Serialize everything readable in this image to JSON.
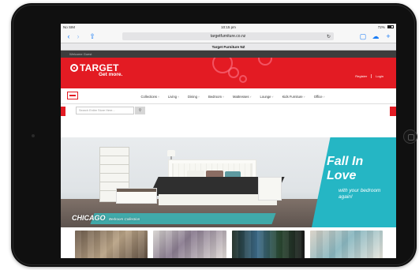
{
  "status_bar": {
    "carrier": "No SIM",
    "time": "10:15 pm",
    "battery": "72%"
  },
  "browser": {
    "url": "targetfurniture.co.nz",
    "tab_title": "Target Furniture NZ"
  },
  "site": {
    "welcome": "Welcome Guest",
    "brand": "TARGET",
    "tagline": "Get more.",
    "header_links": [
      "Register",
      "Login"
    ],
    "nav": [
      "Collections",
      "Living",
      "Dining",
      "Bedroom",
      "Mattresses",
      "Lounge",
      "Kids Furniture",
      "Office"
    ],
    "search_placeholder": "Search Entire Store Here...",
    "hero": {
      "headline": "Fall In Love",
      "sub": "with your bedroom again!",
      "collection": "CHICAGO",
      "collection_sub": "Bedroom Collection"
    }
  },
  "colors": {
    "brand_red": "#e31b23",
    "teal": "#25b6c4",
    "ios_blue": "#1a7cf5"
  },
  "icons": {
    "back": "chevron-left-icon",
    "forward": "chevron-right-icon",
    "share": "share-icon",
    "reload": "reload-icon",
    "bookmarks": "book-icon",
    "cloud_tabs": "cloud-icon",
    "new_tab": "plus-icon",
    "menu": "menu-icon",
    "search": "search-icon"
  }
}
